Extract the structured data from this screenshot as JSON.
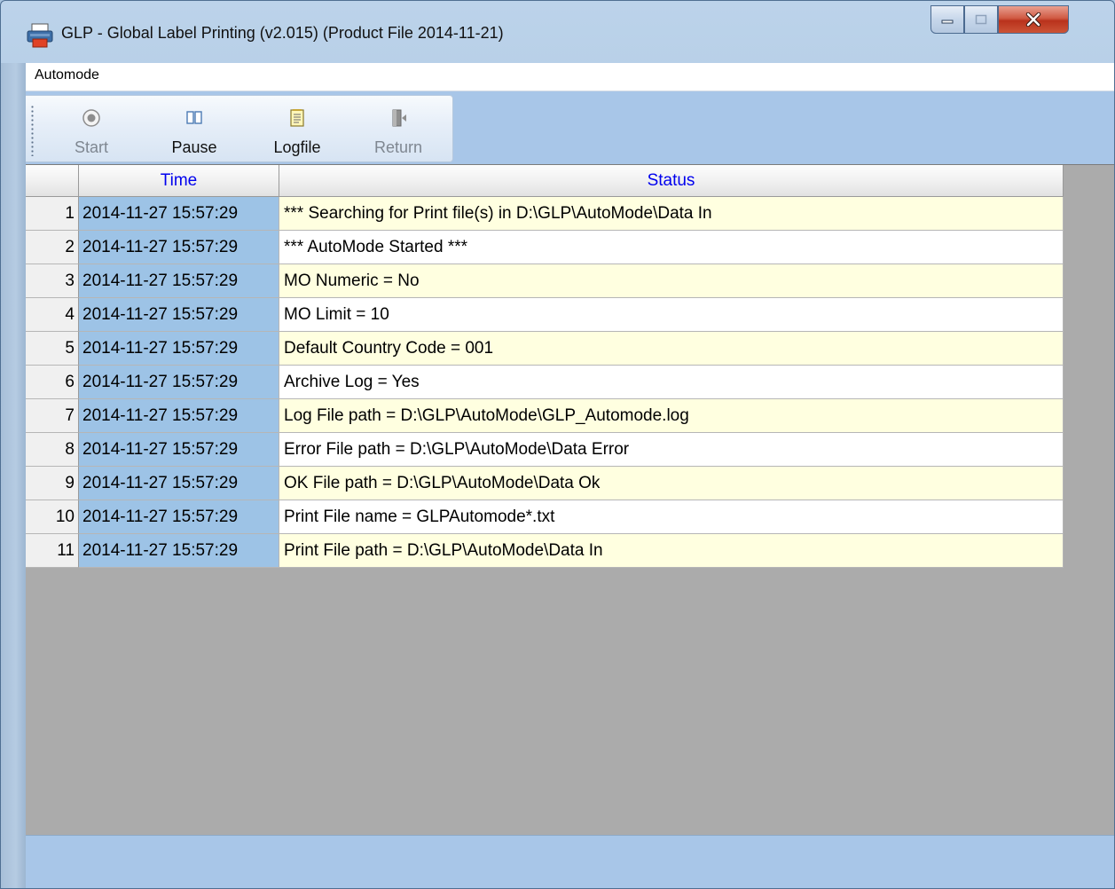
{
  "window": {
    "title": "GLP - Global Label Printing (v2.015) (Product File 2014-11-21)",
    "accent": "#a8c6e8"
  },
  "menu": {
    "items": [
      {
        "label": "Automode"
      }
    ]
  },
  "toolbar": {
    "buttons": [
      {
        "label": "Start",
        "icon": "record-icon",
        "enabled": false
      },
      {
        "label": "Pause",
        "icon": "pause-icon",
        "enabled": true
      },
      {
        "label": "Logfile",
        "icon": "logfile-icon",
        "enabled": true
      },
      {
        "label": "Return",
        "icon": "exit-door-icon",
        "enabled": false
      }
    ]
  },
  "grid": {
    "columns": [
      "",
      "Time",
      "Status"
    ],
    "rows": [
      {
        "n": "1",
        "time": "2014-11-27 15:57:29",
        "status": "*** Searching for Print file(s) in D:\\GLP\\AutoMode\\Data In"
      },
      {
        "n": "2",
        "time": "2014-11-27 15:57:29",
        "status": "*** AutoMode Started ***"
      },
      {
        "n": "3",
        "time": "2014-11-27 15:57:29",
        "status": "MO Numeric = No"
      },
      {
        "n": "4",
        "time": "2014-11-27 15:57:29",
        "status": "MO Limit = 10"
      },
      {
        "n": "5",
        "time": "2014-11-27 15:57:29",
        "status": "Default Country Code = 001"
      },
      {
        "n": "6",
        "time": "2014-11-27 15:57:29",
        "status": "Archive Log = Yes"
      },
      {
        "n": "7",
        "time": "2014-11-27 15:57:29",
        "status": "Log File path = D:\\GLP\\AutoMode\\GLP_Automode.log"
      },
      {
        "n": "8",
        "time": "2014-11-27 15:57:29",
        "status": "Error File path = D:\\GLP\\AutoMode\\Data Error"
      },
      {
        "n": "9",
        "time": "2014-11-27 15:57:29",
        "status": "OK File path = D:\\GLP\\AutoMode\\Data Ok"
      },
      {
        "n": "10",
        "time": "2014-11-27 15:57:29",
        "status": "Print File name = GLPAutomode*.txt"
      },
      {
        "n": "11",
        "time": "2014-11-27 15:57:29",
        "status": "Print File path = D:\\GLP\\AutoMode\\Data In"
      }
    ]
  },
  "colors": {
    "header_text": "#0000ee",
    "time_cell": "#9dc3e6",
    "status_odd": "#ffffe0",
    "status_even": "#ffffff"
  }
}
